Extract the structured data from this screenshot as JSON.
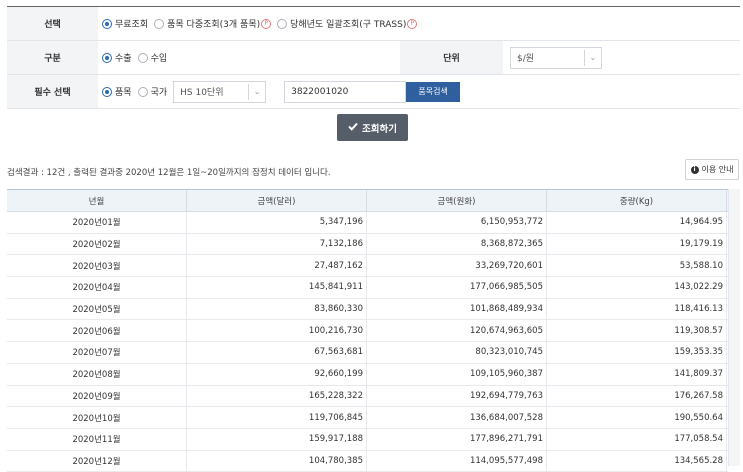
{
  "form": {
    "row1": {
      "label": "선택",
      "options": [
        {
          "label": "무료조회",
          "checked": true,
          "pin": false
        },
        {
          "label": "품목 다중조회(3개 품목)",
          "checked": false,
          "pin": true
        },
        {
          "label": "당해년도 일괄조회(구 TRASS)",
          "checked": false,
          "pin": true
        }
      ],
      "pin_glyph": "P"
    },
    "row2": {
      "label": "구분",
      "options": [
        {
          "label": "수출",
          "checked": true
        },
        {
          "label": "수입",
          "checked": false
        }
      ],
      "unit_label": "단위",
      "unit_value": "$/원"
    },
    "row3": {
      "label": "필수 선택",
      "options": [
        {
          "label": "품목",
          "checked": true
        },
        {
          "label": "국가",
          "checked": false
        }
      ],
      "hs_select": "HS 10단위",
      "code_value": "3822001020",
      "item_search_button": "품목검색"
    }
  },
  "search_button": "조회하기",
  "result_text": "검색결과 : 12건 , 출력된 결과중 2020년 12월은 1일~20일까지의 잠정치 데이터 입니다.",
  "guide_button": "이용 안내",
  "guide_icon_glyph": "i",
  "table": {
    "headers": [
      "년월",
      "금액(달러)",
      "금액(원화)",
      "중량(Kg)"
    ],
    "rows": [
      [
        "2020년01월",
        "5,347,196",
        "6,150,953,772",
        "14,964.95"
      ],
      [
        "2020년02월",
        "7,132,186",
        "8,368,872,365",
        "19,179.19"
      ],
      [
        "2020년03월",
        "27,487,162",
        "33,269,720,601",
        "53,588.10"
      ],
      [
        "2020년04월",
        "145,841,911",
        "177,066,985,505",
        "143,022.29"
      ],
      [
        "2020년05월",
        "83,860,330",
        "101,868,489,934",
        "118,416.13"
      ],
      [
        "2020년06월",
        "100,216,730",
        "120,674,963,605",
        "119,308.57"
      ],
      [
        "2020년07월",
        "67,563,681",
        "80,323,010,745",
        "159,353.35"
      ],
      [
        "2020년08월",
        "92,660,199",
        "109,105,960,387",
        "141,809.37"
      ],
      [
        "2020년09월",
        "165,228,322",
        "192,694,779,763",
        "176,267.58"
      ],
      [
        "2020년10월",
        "119,706,845",
        "136,684,007,528",
        "190,550.64"
      ],
      [
        "2020년11월",
        "159,917,188",
        "177,896,271,791",
        "177,058.54"
      ],
      [
        "2020년12월",
        "104,780,385",
        "114,095,577,498",
        "134,565.28"
      ]
    ]
  }
}
